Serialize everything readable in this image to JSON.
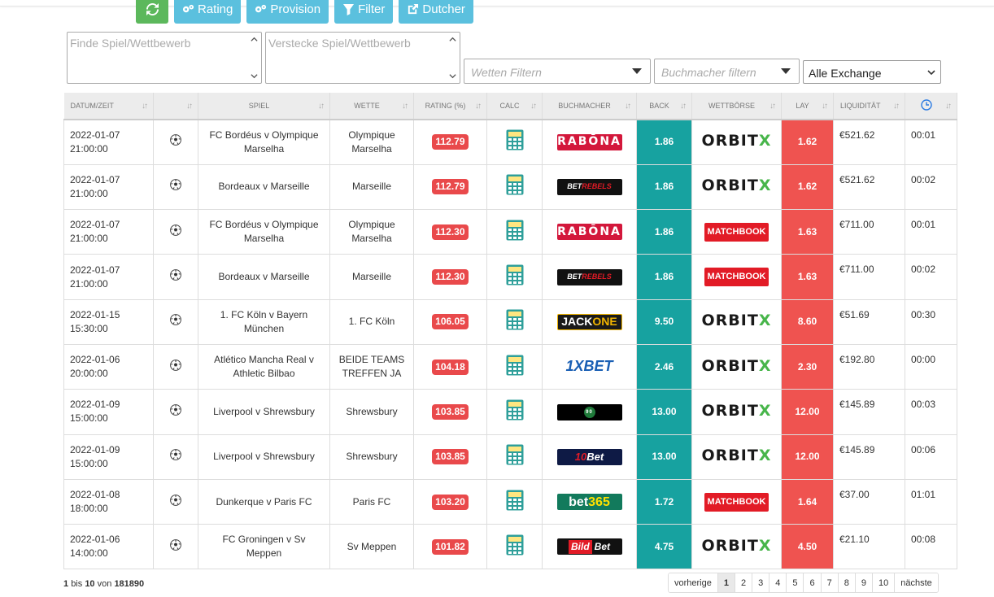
{
  "toolbar": {
    "refresh_icon": "refresh-icon",
    "rating_label": "Rating",
    "provision_label": "Provision",
    "filter_label": "Filter",
    "dutcher_label": "Dutcher"
  },
  "filters": {
    "find_placeholder": "Finde Spiel/Wettbewerb",
    "hide_placeholder": "Verstecke Spiel/Wettbewerb",
    "bets_placeholder": "Wetten Filtern",
    "bookmaker_placeholder": "Buchmacher filtern",
    "exchange_value": "Alle Exchange"
  },
  "columns": {
    "datum": "DATUM/ZEIT",
    "sport": "",
    "spiel": "SPIEL",
    "wette": "WETTE",
    "rating": "RATING (%)",
    "calc": "CALC",
    "buchmacher": "BUCHMACHER",
    "back": "BACK",
    "wettboerse": "WETTBÖRSE",
    "lay": "LAY",
    "liquiditaet": "LIQUIDITÄT",
    "time_icon": "clock-icon"
  },
  "rows": [
    {
      "date": "2022-01-07",
      "time": "21:00:00",
      "spiel1": "FC Bordéus v Olympique",
      "spiel2": "Marselha",
      "wette1": "Olympique",
      "wette2": "Marselha",
      "rating": "112.79",
      "bookmaker": "rabona",
      "back": "1.86",
      "exchange": "orbitx",
      "lay": "1.62",
      "liq": "€521.62",
      "age": "00:01"
    },
    {
      "date": "2022-01-07",
      "time": "21:00:00",
      "spiel1": "Bordeaux v Marseille",
      "spiel2": "",
      "wette1": "Marseille",
      "wette2": "",
      "rating": "112.79",
      "bookmaker": "betrebels",
      "back": "1.86",
      "exchange": "orbitx",
      "lay": "1.62",
      "liq": "€521.62",
      "age": "00:02"
    },
    {
      "date": "2022-01-07",
      "time": "21:00:00",
      "spiel1": "FC Bordéus v Olympique",
      "spiel2": "Marselha",
      "wette1": "Olympique",
      "wette2": "Marselha",
      "rating": "112.30",
      "bookmaker": "rabona",
      "back": "1.86",
      "exchange": "matchbook",
      "lay": "1.63",
      "liq": "€711.00",
      "age": "00:01"
    },
    {
      "date": "2022-01-07",
      "time": "21:00:00",
      "spiel1": "Bordeaux v Marseille",
      "spiel2": "",
      "wette1": "Marseille",
      "wette2": "",
      "rating": "112.30",
      "bookmaker": "betrebels",
      "back": "1.86",
      "exchange": "matchbook",
      "lay": "1.63",
      "liq": "€711.00",
      "age": "00:02"
    },
    {
      "date": "2022-01-15",
      "time": "15:30:00",
      "spiel1": "1. FC Köln v Bayern",
      "spiel2": "München",
      "wette1": "1. FC Köln",
      "wette2": "",
      "rating": "106.05",
      "bookmaker": "jackone",
      "back": "9.50",
      "exchange": "orbitx",
      "lay": "8.60",
      "liq": "€51.69",
      "age": "00:30"
    },
    {
      "date": "2022-01-06",
      "time": "20:00:00",
      "spiel1": "Atlético Mancha Real v",
      "spiel2": "Athletic Bilbao",
      "wette1": "BEIDE TEAMS",
      "wette2": "TREFFEN JA",
      "rating": "104.18",
      "bookmaker": "1xbet",
      "back": "2.46",
      "exchange": "orbitx",
      "lay": "2.30",
      "liq": "€192.80",
      "age": "00:00"
    },
    {
      "date": "2022-01-09",
      "time": "15:00:00",
      "spiel1": "Liverpool v Shrewsbury",
      "spiel2": "",
      "wette1": "Shrewsbury",
      "wette2": "",
      "rating": "103.85",
      "bookmaker": "b90",
      "back": "13.00",
      "exchange": "orbitx",
      "lay": "12.00",
      "liq": "€145.89",
      "age": "00:03"
    },
    {
      "date": "2022-01-09",
      "time": "15:00:00",
      "spiel1": "Liverpool v Shrewsbury",
      "spiel2": "",
      "wette1": "Shrewsbury",
      "wette2": "",
      "rating": "103.85",
      "bookmaker": "10bet",
      "back": "13.00",
      "exchange": "orbitx",
      "lay": "12.00",
      "liq": "€145.89",
      "age": "00:06"
    },
    {
      "date": "2022-01-08",
      "time": "18:00:00",
      "spiel1": "Dunkerque v Paris FC",
      "spiel2": "",
      "wette1": "Paris FC",
      "wette2": "",
      "rating": "103.20",
      "bookmaker": "bet365",
      "back": "1.72",
      "exchange": "matchbook",
      "lay": "1.64",
      "liq": "€37.00",
      "age": "01:01"
    },
    {
      "date": "2022-01-06",
      "time": "14:00:00",
      "spiel1": "FC Groningen v Sv",
      "spiel2": "Meppen",
      "wette1": "Sv Meppen",
      "wette2": "",
      "rating": "101.82",
      "bookmaker": "bildbet",
      "back": "4.75",
      "exchange": "orbitx",
      "lay": "4.50",
      "liq": "€21.10",
      "age": "00:08"
    }
  ],
  "logos": {
    "rabona": "RABŌNA",
    "betrebels_a": "BET",
    "betrebels_b": "REBELS",
    "jackone_a": "JACK",
    "jackone_b": "ONE",
    "xbet": "1XBET",
    "b90": "90",
    "tenbet_a": "10",
    "tenbet_b": "Bet",
    "bet365_a": "bet",
    "bet365_b": "365",
    "bildbet_a": "Bild",
    "bildbet_b": "Bet",
    "orbitx_a": "ORBIT",
    "orbitx_b": "X",
    "matchbook": "MATCHBOOK"
  },
  "summary": {
    "from": "1",
    "bis": "bis",
    "to": "10",
    "von": "von",
    "total": "181890"
  },
  "pagination": {
    "prev": "vorherige",
    "pages": [
      "1",
      "2",
      "3",
      "4",
      "5",
      "6",
      "7",
      "8",
      "9",
      "10"
    ],
    "next": "nächste",
    "active": "1"
  },
  "colors": {
    "back": "#17a2a0",
    "lay": "#ef5350",
    "rating": "#e9494b",
    "refresh_button": "#5cb85c",
    "toolbar_button": "#5bc0de"
  }
}
